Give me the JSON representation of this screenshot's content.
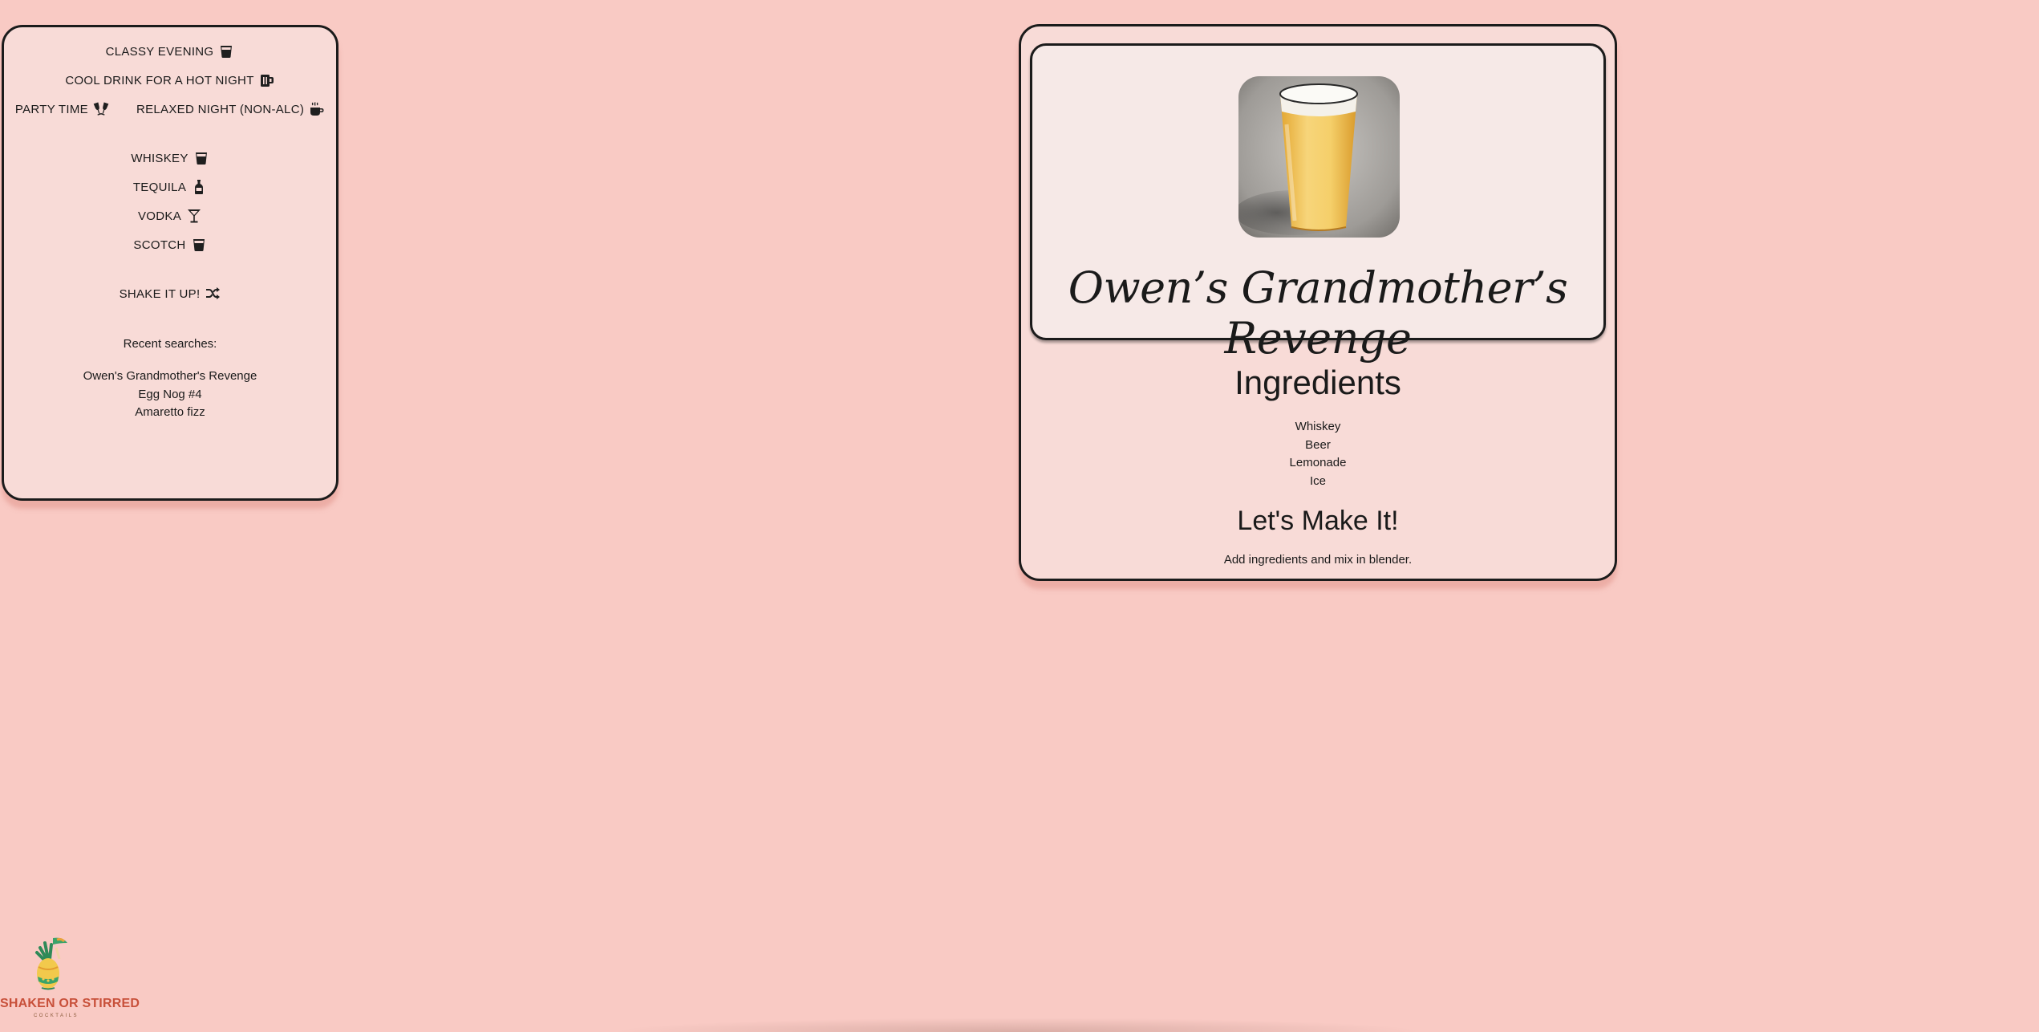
{
  "sidebar": {
    "moods": [
      {
        "label": "Classy Evening",
        "icon": "whiskey-glass-icon"
      },
      {
        "label": "Cool Drink for a Hot Night",
        "icon": "beer-mug-icon"
      },
      {
        "label": "Party Time",
        "icon": "champagne-glasses-icon"
      },
      {
        "label": "Relaxed Night (Non-Alc)",
        "icon": "coffee-mug-icon"
      }
    ],
    "spirits": [
      {
        "label": "Whiskey",
        "icon": "whiskey-glass-icon"
      },
      {
        "label": "Tequila",
        "icon": "bottle-icon"
      },
      {
        "label": "Vodka",
        "icon": "martini-glass-icon"
      },
      {
        "label": "Scotch",
        "icon": "whiskey-glass-icon"
      }
    ],
    "shake": {
      "label": "Shake it up!",
      "icon": "shuffle-icon"
    },
    "recent_label": "Recent searches:",
    "recent": [
      "Owen's Grandmother's Revenge",
      "Egg Nog #4",
      "Amaretto fizz"
    ]
  },
  "drink": {
    "name": "Owen’s Grandmother’s Revenge",
    "ingredients_title": "Ingredients",
    "ingredients": [
      "Whiskey",
      "Beer",
      "Lemonade",
      "Ice"
    ],
    "instructions_title": "Let's Make It!",
    "instructions": "Add ingredients and mix in blender."
  },
  "logo": {
    "name": "SHAKEN OR STIRRED",
    "tagline": "COCKTAILS"
  },
  "colors": {
    "background": "#f9cac4",
    "panel": "#f8dbd7",
    "header_panel": "#f6e9e7",
    "border": "#1b1b1b",
    "logo_red": "#c8503a"
  }
}
